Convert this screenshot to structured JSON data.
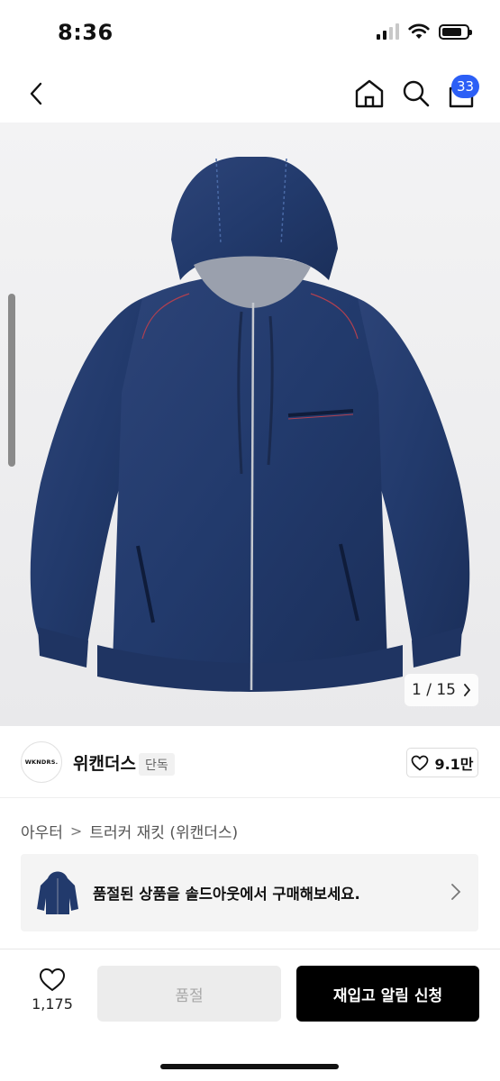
{
  "status_bar": {
    "time": "8:36",
    "signal_icon": "cellular-signal-icon",
    "wifi_icon": "wifi-icon",
    "battery_icon": "battery-icon",
    "battery_level": 0.8
  },
  "nav": {
    "back_icon": "chevron-left-icon",
    "home_icon": "home-icon",
    "search_icon": "search-icon",
    "cart_icon": "cart-icon",
    "cart_badge": "33",
    "accent_color": "#2c5ff6"
  },
  "gallery": {
    "current": "1",
    "separator": "/",
    "total": "15",
    "next_icon": "chevron-right-icon"
  },
  "brand": {
    "logo_text": "WKNDRS.",
    "name": "위캔더스",
    "tag": "단독",
    "like_icon": "heart-outline-icon",
    "like_count": "9.1만"
  },
  "breadcrumb": {
    "category": "아우터",
    "separator": ">",
    "product": "트러커 재킷 (위캔더스)"
  },
  "banner": {
    "text": "품절된 상품을 솔드아웃에서 구매해보세요.",
    "chevron_icon": "chevron-right-icon"
  },
  "bottom_bar": {
    "wish_icon": "heart-outline-icon",
    "wish_count": "1,175",
    "soldout_label": "품절",
    "restock_label": "재입고 알림 신청"
  }
}
